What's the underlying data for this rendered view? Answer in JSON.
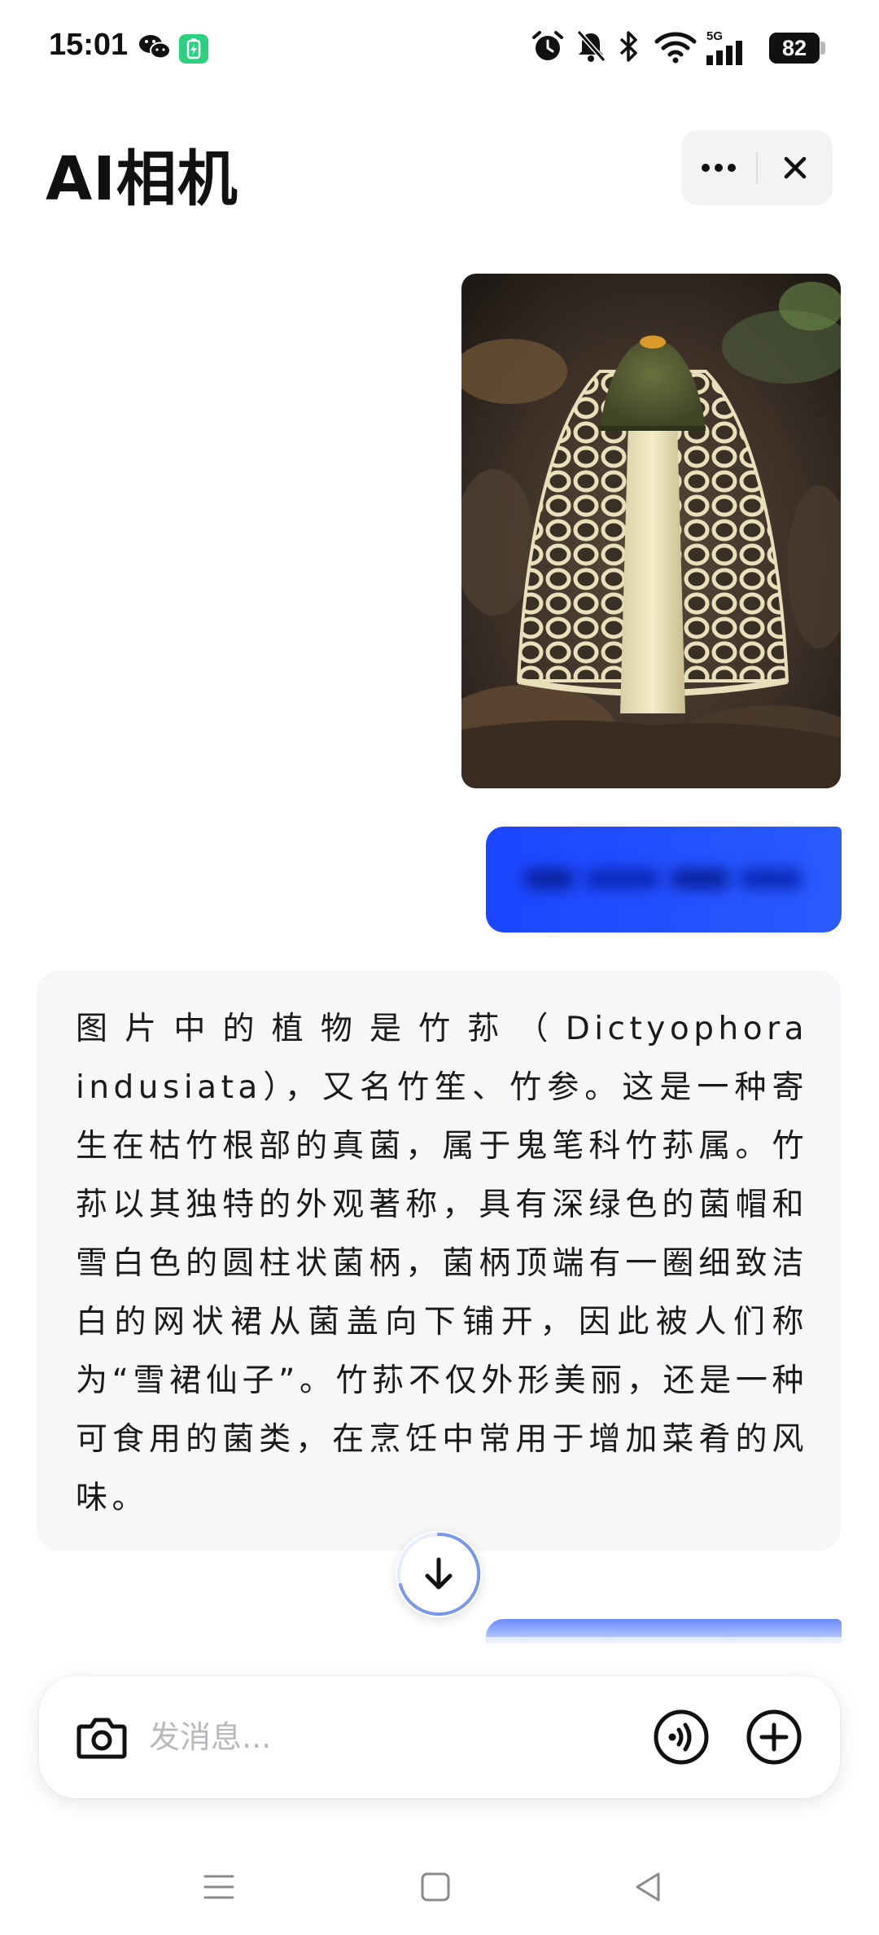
{
  "status_bar": {
    "time": "15:01",
    "network": "5G",
    "battery": "82",
    "icons": [
      "wechat-icon",
      "battery-saver-icon",
      "alarm-icon",
      "mute-icon",
      "bluetooth-icon",
      "wifi-icon",
      "signal-icon",
      "battery-icon"
    ]
  },
  "header": {
    "title": "AI相机",
    "more_icon": "more-icon",
    "close_icon": "close-icon"
  },
  "chat": {
    "photo_subject": "mushroom-photo",
    "user_message": "",
    "ai_message": "图片中的植物是竹荪（Dictyophora indusiata），又名竹笙、竹参。这是一种寄生在枯竹根部的真菌，属于鬼笔科竹荪属。竹荪以其独特的外观著称，具有深绿色的菌帽和雪白色的圆柱状菌柄，菌柄顶端有一圈细致洁白的网状裙从菌盖向下铺开，因此被人们称为“雪裙仙子”。竹荪不仅外形美丽，还是一种可食用的菌类，在烹饪中常用于增加菜肴的风味。",
    "scroll_down_icon": "arrow-down-icon"
  },
  "input": {
    "placeholder": "发消息...",
    "camera_icon": "camera-icon",
    "voice_icon": "voice-icon",
    "plus_icon": "plus-icon"
  },
  "nav": {
    "icons": [
      "menu-icon",
      "home-icon",
      "back-icon"
    ]
  },
  "colors": {
    "accent": "#2150ff",
    "bubble_bg": "#f7f7f9",
    "capsule_bg": "#f3f3f4",
    "placeholder": "#b8b8bd"
  }
}
